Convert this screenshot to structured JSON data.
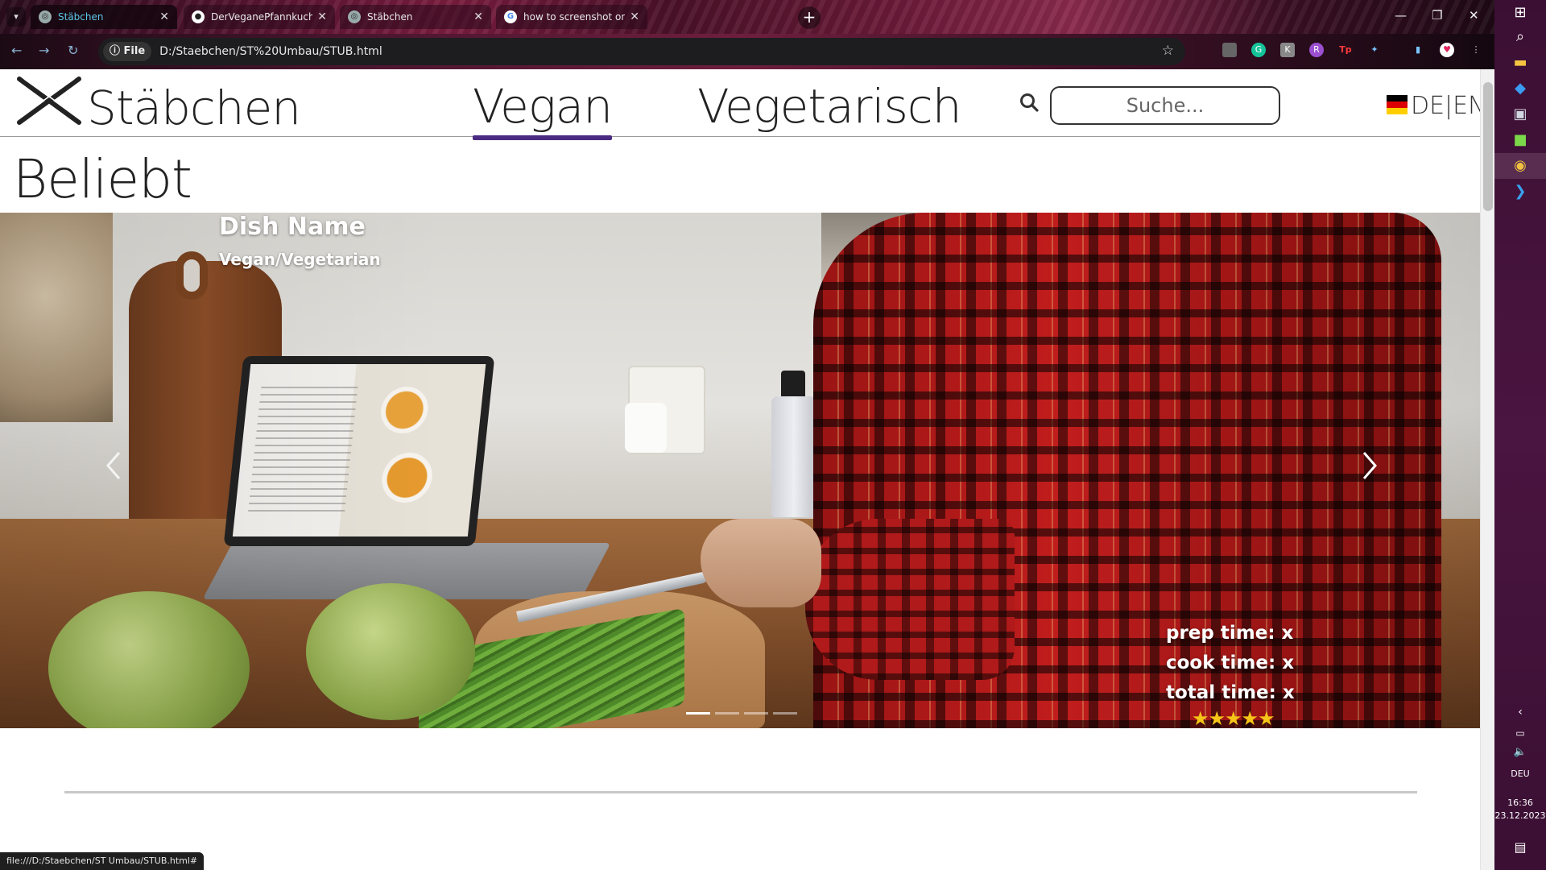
{
  "browser": {
    "tabs": [
      {
        "label": "Stäbchen",
        "active": true
      },
      {
        "label": "DerVeganePfannkuchen/Staeb",
        "active": false
      },
      {
        "label": "Stäbchen",
        "active": false
      },
      {
        "label": "how to screenshot on windows",
        "active": false
      }
    ],
    "omnibox": {
      "chip": "File",
      "url": "D:/Staebchen/ST%20Umbau/STUB.html"
    },
    "status_url": "file:///D:/Staebchen/ST Umbau/STUB.html#",
    "icons": {
      "tab_list": "chevron-down-icon",
      "new_tab": "plus-icon",
      "back": "arrow-left-icon",
      "forward": "arrow-right-icon",
      "reload": "reload-icon",
      "info": "info-icon",
      "bookmark": "star-icon"
    }
  },
  "site": {
    "logo_text": "Stäbchen",
    "nav": [
      {
        "label": "Vegan",
        "active": true
      },
      {
        "label": "Vegetarisch",
        "active": false
      }
    ],
    "search": {
      "placeholder": "Suche..."
    },
    "language": "DE|EN",
    "accent_color": "#4b2a82"
  },
  "main": {
    "section_title": "Beliebt",
    "carousel": {
      "dish_name": "Dish Name",
      "dish_type": "Vegan/Vegetarian",
      "prep_time": "prep time: x",
      "cook_time": "cook time: x",
      "total_time": "total time: x",
      "rating_stars": "★★★★★",
      "rating": 5,
      "slides": 4,
      "active_slide": 1
    }
  },
  "taskbar": {
    "language": "DEU",
    "time": "16:36",
    "date": "23.12.2023"
  }
}
